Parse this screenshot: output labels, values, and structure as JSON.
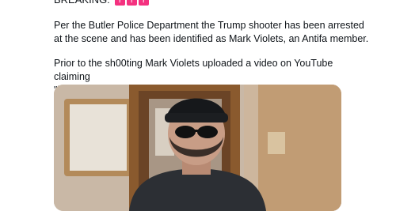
{
  "tweet": {
    "headline": "BREAKING:",
    "alert_icons": [
      "!",
      "!",
      "!"
    ],
    "paragraph_1": "Per the Butler Police Department the Trump shooter has been arrested\nat the scene and has been identified as Mark Violets, an Antifa member.",
    "paragraph_2": "Prior to the sh00ting Mark Violets uploaded a video on YouTube claiming\n\"justice is coming\"."
  },
  "media": {
    "type": "video-still",
    "colors": {
      "wall": "#c9b8a6",
      "door_frame": "#8a5a2e",
      "hoodie": "#2c2f34",
      "beanie": "#16181b",
      "skin": "#c89d86"
    }
  }
}
